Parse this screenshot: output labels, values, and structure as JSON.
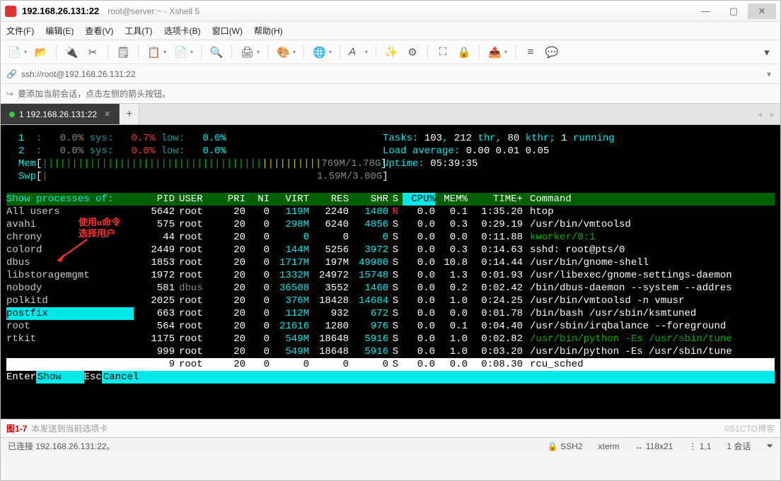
{
  "title": {
    "ip": "192.168.26.131:22",
    "sub": "root@server:~ - Xshell 5"
  },
  "menu": [
    "文件(F)",
    "编辑(E)",
    "查看(V)",
    "工具(T)",
    "选项卡(B)",
    "窗口(W)",
    "帮助(H)"
  ],
  "addr": {
    "url": "ssh://root@192.168.26.131:22"
  },
  "hint": "要添加当前会话，点击左侧的箭头按钮。",
  "tab": {
    "label": "1 192.168.26.131:22"
  },
  "annot": {
    "l1": "使用u命令",
    "l2": "选择用户"
  },
  "htop": {
    "cpu": [
      {
        "id": "1",
        "user": "0.0%",
        "sys": "0.7%",
        "low": "0.0%"
      },
      {
        "id": "2",
        "user": "0.0%",
        "sys": "0.0%",
        "low": "0.0%"
      }
    ],
    "mem": {
      "bar": "|||||||||||||||||||||||||||||||||||||",
      "val": "769M/1.78G"
    },
    "swp": {
      "bar": "|",
      "val": "1.59M/3.00G"
    },
    "tasksLine": {
      "tasks": "103",
      "total": "212",
      "thr": "80",
      "running": "1"
    },
    "load": {
      "a": "0.00",
      "b": "0.01",
      "c": "0.05"
    },
    "uptime": "05:39:35",
    "showLabel": "Show processes of:",
    "hdr": {
      "pid": "PID",
      "user": "USER",
      "pri": "PRI",
      "ni": "NI",
      "virt": "VIRT",
      "res": "RES",
      "shr": "SHR",
      "s": "S",
      "cpu": "CPU%",
      "mem": "MEM%",
      "time": "TIME+",
      "cmd": "Command"
    },
    "users": [
      "All users",
      "avahi",
      "chrony",
      "colord",
      "dbus",
      "libstoragemgmt",
      "nobody",
      "polkitd",
      "postfix",
      "root",
      "rtkit",
      "",
      ""
    ],
    "selUserIdx": 8,
    "rows": [
      {
        "pid": "5642",
        "user": "root",
        "pri": "20",
        "ni": "0",
        "virt": "119M",
        "res": "2240",
        "shr": "1480",
        "s": "R",
        "cpu": "0.0",
        "mem": "0.1",
        "time": "1:35.20",
        "cmd": "htop",
        "cmdColor": "c-white"
      },
      {
        "pid": "575",
        "user": "root",
        "pri": "20",
        "ni": "0",
        "virt": "298M",
        "res": "6240",
        "shr": "4856",
        "s": "S",
        "cpu": "0.0",
        "mem": "0.3",
        "time": "0:29.19",
        "cmd": "/usr/bin/vmtoolsd",
        "cmdColor": "c-white"
      },
      {
        "pid": "44",
        "user": "root",
        "pri": "20",
        "ni": "0",
        "virt": "0",
        "res": "0",
        "shr": "0",
        "s": "S",
        "cpu": "0.0",
        "mem": "0.0",
        "time": "0:11.88",
        "cmd": "kworker/0:1",
        "cmdColor": "c-green"
      },
      {
        "pid": "2449",
        "user": "root",
        "pri": "20",
        "ni": "0",
        "virt": "144M",
        "res": "5256",
        "shr": "3972",
        "s": "S",
        "cpu": "0.0",
        "mem": "0.3",
        "time": "0:14.63",
        "cmd": "sshd: root@pts/0",
        "cmdColor": "c-white"
      },
      {
        "pid": "1853",
        "user": "root",
        "pri": "20",
        "ni": "0",
        "virt": "1717M",
        "res": "197M",
        "shr": "49980",
        "s": "S",
        "cpu": "0.0",
        "mem": "10.8",
        "time": "0:14.44",
        "cmd": "/usr/bin/gnome-shell",
        "cmdColor": "c-white"
      },
      {
        "pid": "1972",
        "user": "root",
        "pri": "20",
        "ni": "0",
        "virt": "1332M",
        "res": "24972",
        "shr": "15748",
        "s": "S",
        "cpu": "0.0",
        "mem": "1.3",
        "time": "0:01.93",
        "cmd": "/usr/libexec/gnome-settings-daemon",
        "cmdColor": "c-white"
      },
      {
        "pid": "581",
        "user": "dbus",
        "pri": "20",
        "ni": "0",
        "virt": "36508",
        "res": "3552",
        "shr": "1460",
        "s": "S",
        "cpu": "0.0",
        "mem": "0.2",
        "time": "0:02.42",
        "cmd": "/bin/dbus-daemon --system --addres",
        "cmdColor": "c-white"
      },
      {
        "pid": "2025",
        "user": "root",
        "pri": "20",
        "ni": "0",
        "virt": "376M",
        "res": "18428",
        "shr": "14684",
        "s": "S",
        "cpu": "0.0",
        "mem": "1.0",
        "time": "0:24.25",
        "cmd": "/usr/bin/vmtoolsd -n vmusr",
        "cmdColor": "c-white"
      },
      {
        "pid": "663",
        "user": "root",
        "pri": "20",
        "ni": "0",
        "virt": "112M",
        "res": "932",
        "shr": "672",
        "s": "S",
        "cpu": "0.0",
        "mem": "0.0",
        "time": "0:01.78",
        "cmd": "/bin/bash /usr/sbin/ksmtuned",
        "cmdColor": "c-white"
      },
      {
        "pid": "564",
        "user": "root",
        "pri": "20",
        "ni": "0",
        "virt": "21616",
        "res": "1280",
        "shr": "976",
        "s": "S",
        "cpu": "0.0",
        "mem": "0.1",
        "time": "0:04.40",
        "cmd": "/usr/sbin/irqbalance --foreground",
        "cmdColor": "c-white"
      },
      {
        "pid": "1175",
        "user": "root",
        "pri": "20",
        "ni": "0",
        "virt": "549M",
        "res": "18648",
        "shr": "5916",
        "s": "S",
        "cpu": "0.0",
        "mem": "1.0",
        "time": "0:02.82",
        "cmd": "/usr/bin/python -Es /usr/sbin/tune",
        "cmdColor": "c-green"
      },
      {
        "pid": "999",
        "user": "root",
        "pri": "20",
        "ni": "0",
        "virt": "549M",
        "res": "18648",
        "shr": "5916",
        "s": "S",
        "cpu": "0.0",
        "mem": "1.0",
        "time": "0:03.20",
        "cmd": "/usr/bin/python -Es /usr/sbin/tune",
        "cmdColor": "c-white"
      }
    ],
    "selRow": {
      "pid": "9",
      "user": "root",
      "pri": "20",
      "ni": "0",
      "virt": "0",
      "res": "0",
      "shr": "0",
      "s": "S",
      "cpu": "0.0",
      "mem": "0.0",
      "time": "0:08.30",
      "cmd": "rcu_sched"
    },
    "footer": {
      "enter": "Enter",
      "show": "Show",
      "esc": "Esc",
      "cancel": "Cancel"
    }
  },
  "sendbar": {
    "fig": "图1-7",
    "txt": "本发送到当前选项卡"
  },
  "watermark": "©51CTO博客",
  "status": {
    "conn": "已连接 192.168.26.131:22。",
    "ssh": "SSH2",
    "term": "xterm",
    "size": "118x21",
    "pos": "1,1",
    "sess": "1 会话"
  }
}
